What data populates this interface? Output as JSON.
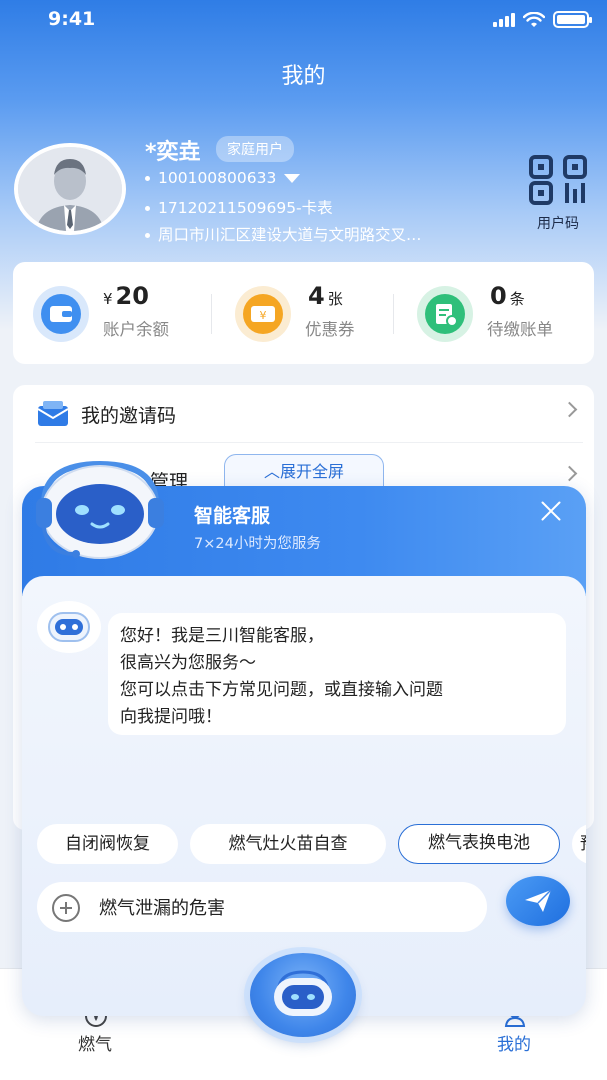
{
  "status_bar": {
    "time": "9:41"
  },
  "header": {
    "title": "我的"
  },
  "user": {
    "name": "*奕垚",
    "tag": "家庭用户",
    "account_no": "100100800633",
    "meter_no": "17120211509695-卡表",
    "address": "周口市川汇区建设大道与文明路交叉…"
  },
  "qr": {
    "label": "用户码"
  },
  "stats": [
    {
      "prefix": "¥",
      "value": "20",
      "unit": "",
      "label": "账户余额",
      "icon": "wallet-icon"
    },
    {
      "prefix": "",
      "value": "4",
      "unit": "张",
      "label": "优惠券",
      "icon": "coupon-icon"
    },
    {
      "prefix": "",
      "value": "0",
      "unit": "条",
      "label": "待缴账单",
      "icon": "bill-icon"
    }
  ],
  "menu": [
    {
      "label": "我的邀请码",
      "icon": "invite-mail-icon"
    },
    {
      "label": "管理",
      "icon": "manage-icon"
    }
  ],
  "expand_button": "︿展开全屏",
  "cs": {
    "title": "智能客服",
    "subtitle": "7×24小时为您服务",
    "greeting_lines": [
      "您好！我是三川智能客服，",
      "很高兴为您服务～",
      "您可以点击下方常见问题，或直接输入问题",
      "向我提问哦！"
    ],
    "chips": [
      "自闭阀恢复",
      "燃气灶火苗自查",
      "燃气表换电池",
      "预"
    ],
    "input_value": "燃气泄漏的危害"
  },
  "tabs": [
    {
      "label": "燃气",
      "active": false
    },
    {
      "label": "我的",
      "active": true
    }
  ],
  "colors": {
    "primary": "#2a6fd6",
    "active_tab": "#2a6fd6"
  }
}
